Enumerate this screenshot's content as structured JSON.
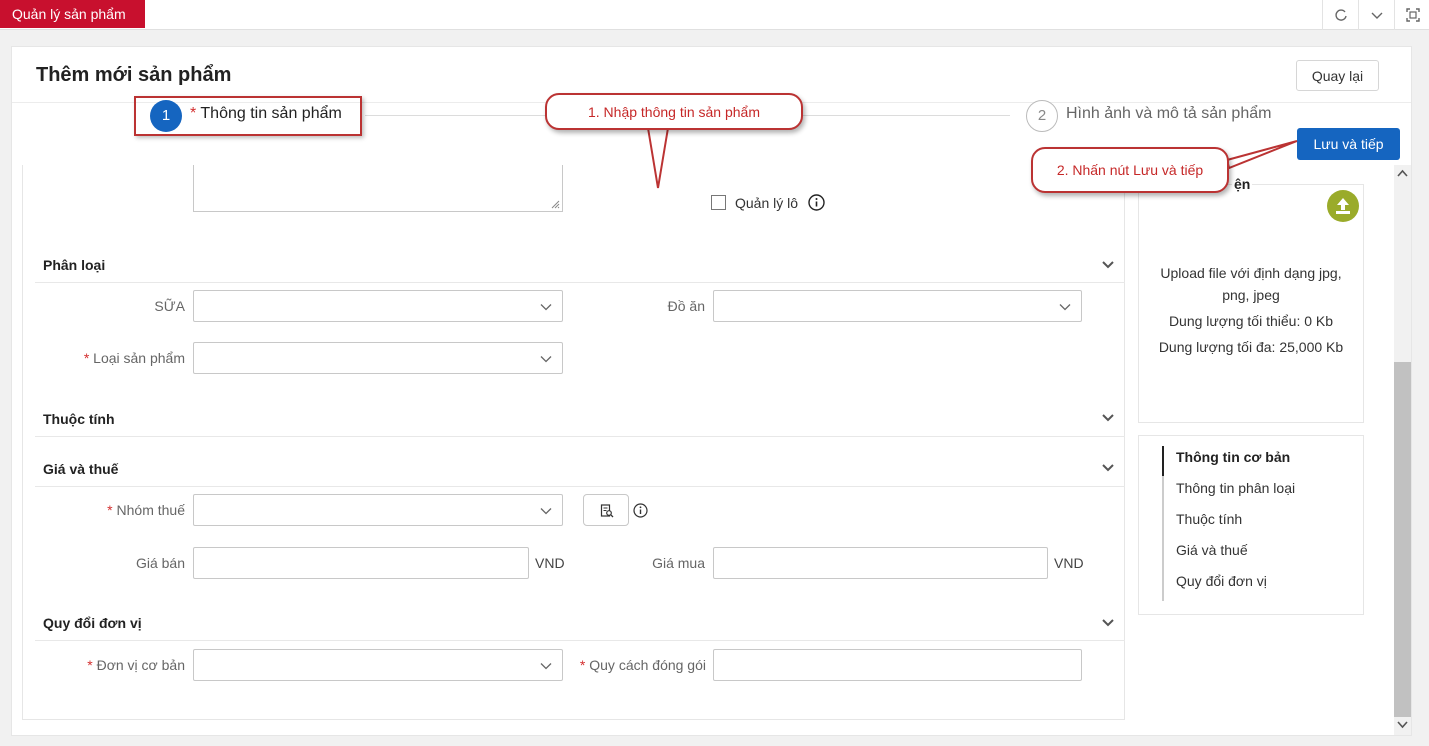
{
  "app": {
    "tab_title": "Quản lý sản phẩm"
  },
  "header": {
    "title": "Thêm mới sản phẩm",
    "back_label": "Quay lại"
  },
  "steps": {
    "step1": {
      "number": "1",
      "required_mark": "*",
      "label": "Thông tin sản phẩm"
    },
    "step2": {
      "number": "2",
      "label": "Hình ảnh và mô tả sản phẩm"
    },
    "save_next_label": "Lưu và tiếp"
  },
  "callouts": {
    "c1": "1. Nhập thông tin sản phẩm",
    "c2": "2. Nhấn nút Lưu và tiếp"
  },
  "form": {
    "batch_label": "Quản lý lô",
    "sections": {
      "classification": "Phân loại",
      "attributes": "Thuộc tính",
      "price_tax": "Giá và thuế",
      "unit_conversion": "Quy đổi đơn vị"
    },
    "fields": {
      "sua": "SỮA",
      "do_an": "Đồ ăn",
      "product_type": "Loại sản phẩm",
      "tax_group": "Nhóm thuế",
      "sell_price": "Giá bán",
      "buy_price": "Giá mua",
      "currency": "VND",
      "base_unit": "Đơn vị cơ bản",
      "packing": "Quy cách đóng gói",
      "req": "*"
    }
  },
  "upload": {
    "title_fragment": "ện",
    "line1": "Upload file với định dạng jpg,",
    "line2": "png, jpeg",
    "line3": "Dung lượng tối thiểu: 0 Kb",
    "line4": "Dung lượng tối đa: 25,000 Kb"
  },
  "toc": {
    "items": [
      "Thông tin cơ bản",
      "Thông tin phân loại",
      "Thuộc tính",
      "Giá và thuế",
      "Quy đổi đơn vị"
    ]
  }
}
